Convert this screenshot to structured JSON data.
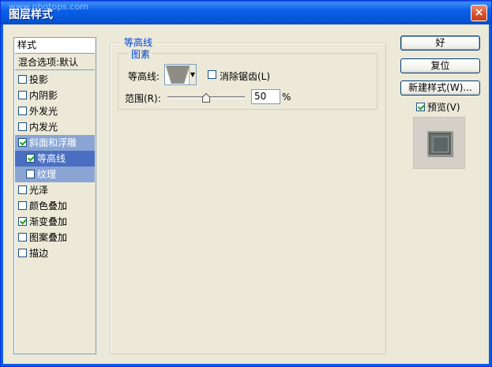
{
  "window": {
    "title": "图层样式",
    "watermark": "www.photops.com",
    "close_glyph": "×"
  },
  "style_list": {
    "header": "样式",
    "items": [
      {
        "label": "混合选项:默认",
        "checkbox": false
      },
      {
        "label": "投影",
        "checkbox": true,
        "checked": false
      },
      {
        "label": "内阴影",
        "checkbox": true,
        "checked": false
      },
      {
        "label": "外发光",
        "checkbox": true,
        "checked": false
      },
      {
        "label": "内发光",
        "checkbox": true,
        "checked": false
      },
      {
        "label": "斜面和浮雕",
        "checkbox": true,
        "checked": true
      },
      {
        "label": "等高线",
        "checkbox": true,
        "checked": true
      },
      {
        "label": "纹理",
        "checkbox": true,
        "checked": false
      },
      {
        "label": "光泽",
        "checkbox": true,
        "checked": false
      },
      {
        "label": "颜色叠加",
        "checkbox": true,
        "checked": false
      },
      {
        "label": "渐变叠加",
        "checkbox": true,
        "checked": true
      },
      {
        "label": "图案叠加",
        "checkbox": true,
        "checked": false
      },
      {
        "label": "描边",
        "checkbox": true,
        "checked": false
      }
    ]
  },
  "contour_panel": {
    "group_title": "等高线",
    "subgroup_title": "图素",
    "contour_label": "等高线:",
    "anti_alias_label": "消除锯齿(L)",
    "anti_alias_checked": false,
    "range_label": "范围(R):",
    "range_value": "50",
    "range_unit": "%",
    "range_slider_value": 0.5
  },
  "buttons": {
    "ok": "好",
    "reset": "复位",
    "new_style": "新建样式(W)..."
  },
  "preview": {
    "label": "预览(V)",
    "checked": true
  },
  "colors": {
    "dialog_bg": "#ece9d8",
    "title_bar": "#0a5fe8",
    "selection": "#4a6ec1",
    "group_title": "#0046d5"
  }
}
